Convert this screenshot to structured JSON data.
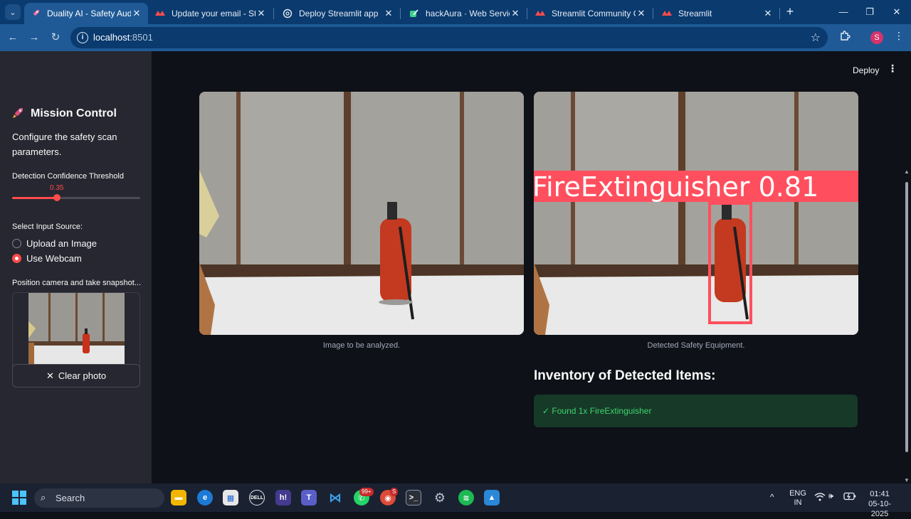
{
  "browser": {
    "tabs": [
      {
        "title": "Duality AI - Safety Auditor",
        "active": true,
        "icon": "rocket-icon"
      },
      {
        "title": "Update your email - Stream",
        "active": false,
        "icon": "streamlit-icon"
      },
      {
        "title": "Deploy Streamlit app",
        "active": false,
        "icon": "openai-icon"
      },
      {
        "title": "hackAura · Web Service · ",
        "active": false,
        "icon": "render-icon"
      },
      {
        "title": "Streamlit Community Clou",
        "active": false,
        "icon": "streamlit-icon"
      },
      {
        "title": "Streamlit",
        "active": false,
        "icon": "streamlit-icon"
      }
    ],
    "url_host": "localhost",
    "url_port": ":8501",
    "profile_initial": "S"
  },
  "header": {
    "deploy_label": "Deploy"
  },
  "sidebar": {
    "title": "Mission Control",
    "description": "Configure the safety scan parameters.",
    "slider_label": "Detection Confidence Threshold",
    "slider_value": "0.35",
    "slider_fraction": 0.35,
    "input_source_label": "Select Input Source:",
    "options": [
      {
        "label": "Upload an Image",
        "selected": false
      },
      {
        "label": "Use Webcam",
        "selected": true
      }
    ],
    "camera_label": "Position camera and take snapshot...",
    "clear_photo_label": "Clear photo"
  },
  "main": {
    "input_caption": "Image to be analyzed.",
    "output_caption": "Detected Safety Equipment.",
    "detection_label": "FireExtinguisher 0.81",
    "inventory_title": "Inventory of Detected Items:",
    "inventory_items": [
      "✓ Found 1x FireExtinguisher"
    ]
  },
  "taskbar": {
    "search_placeholder": "Search",
    "whatsapp_badge": "99+",
    "chrome_badge": "S",
    "lang_line1": "ENG",
    "lang_line2": "IN",
    "time": "01:41",
    "date": "05-10-2025"
  },
  "colors": {
    "accent": "#ff4b4b",
    "success_text": "#3dd56d",
    "success_bg": "#173928",
    "sidebar_bg": "#262730",
    "app_bg": "#0e1117"
  }
}
